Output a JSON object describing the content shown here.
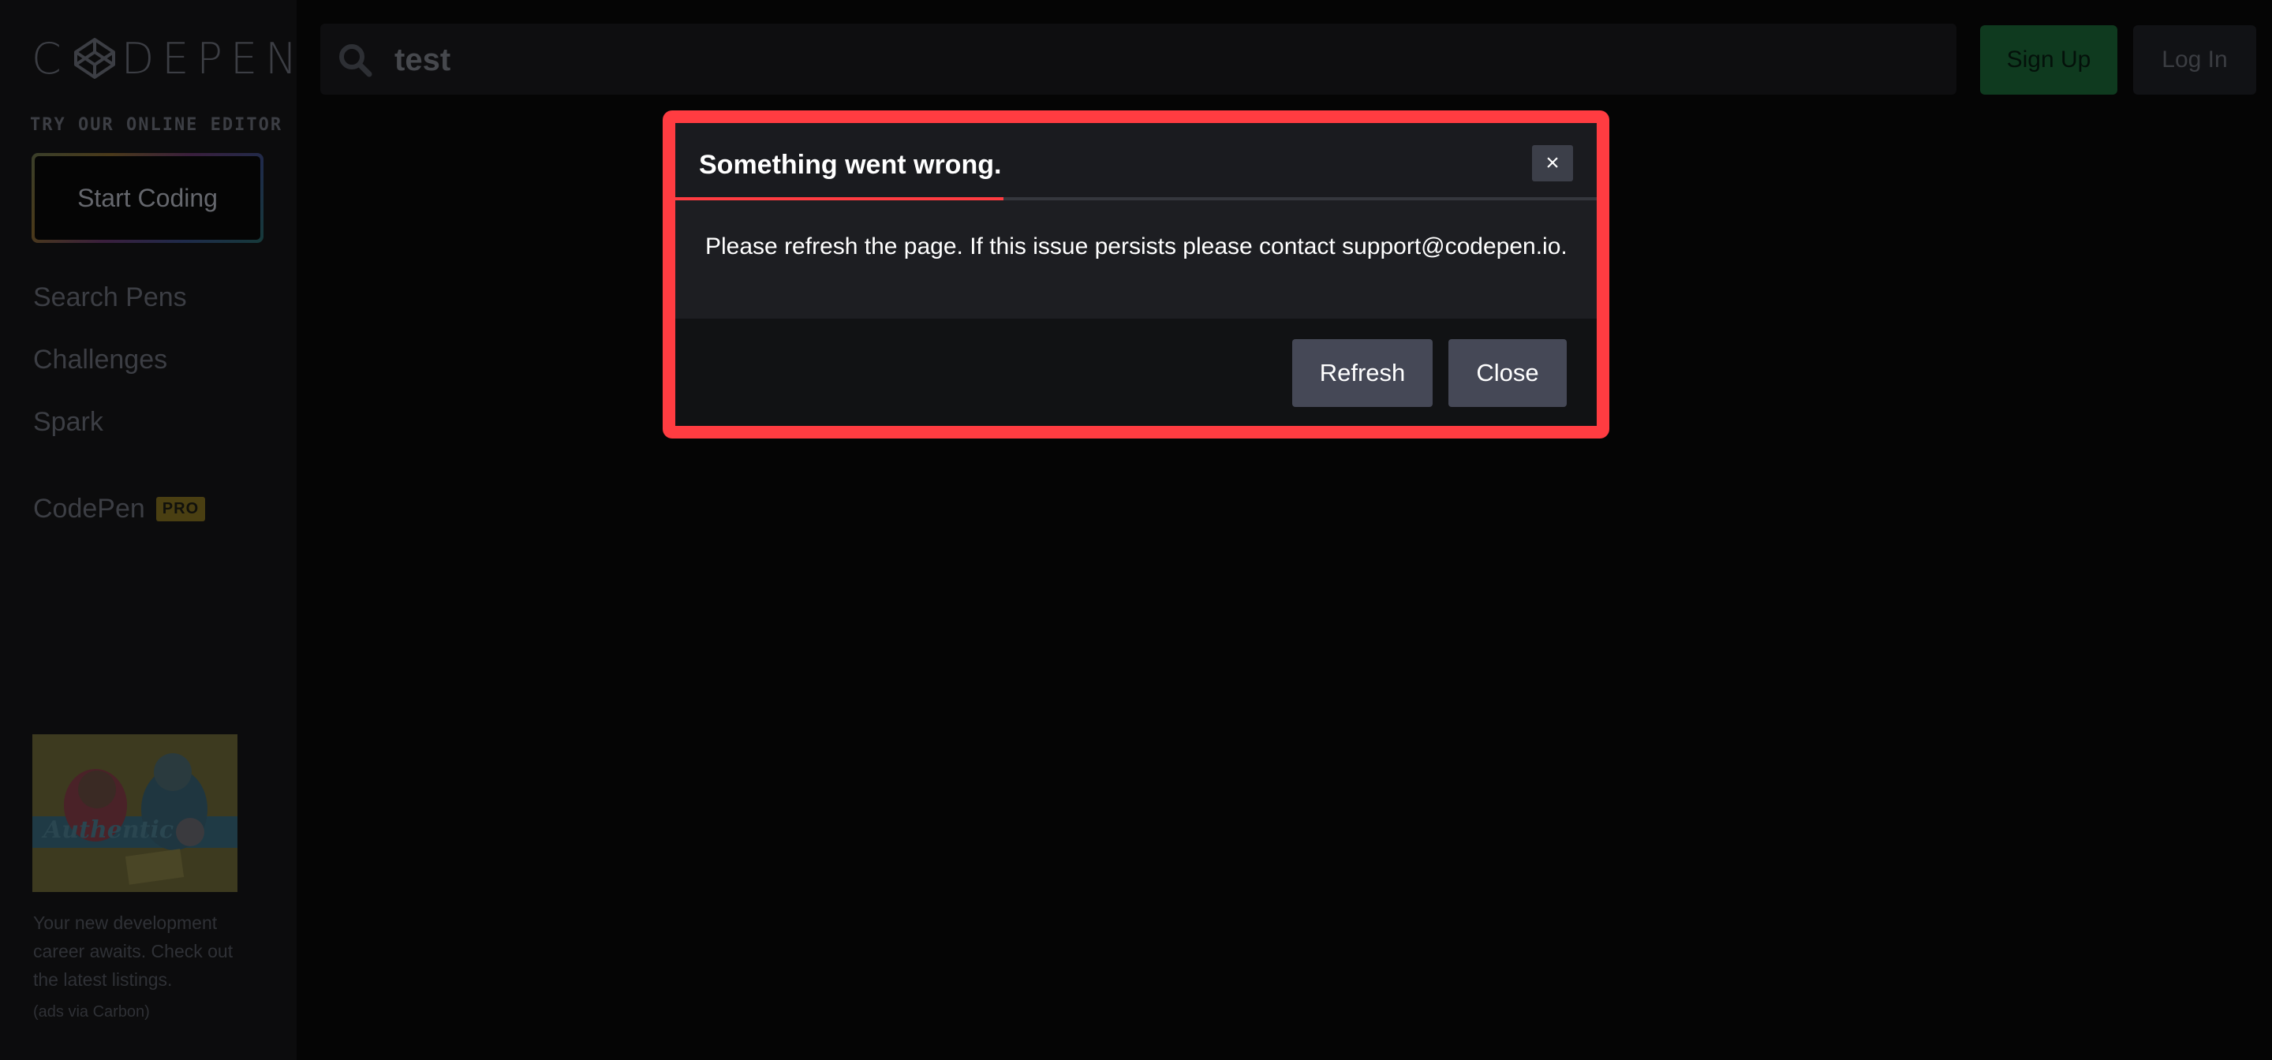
{
  "sidebar": {
    "logo_text": "CODEPEN",
    "try_label": "TRY OUR ONLINE EDITOR",
    "start_button": "Start Coding",
    "nav": [
      {
        "label": "Search Pens"
      },
      {
        "label": "Challenges"
      },
      {
        "label": "Spark"
      }
    ],
    "pro": {
      "label": "CodePen",
      "badge": "PRO"
    },
    "ad": {
      "image_text": "Authentic",
      "text": "Your new development career awaits. Check out the latest listings.",
      "via": "(ads via Carbon)"
    }
  },
  "header": {
    "search_value": "test",
    "signup": "Sign Up",
    "login": "Log In"
  },
  "modal": {
    "title": "Something went wrong.",
    "close_icon": "×",
    "message": "Please refresh the page. If this issue persists please contact support@codepen.io.",
    "refresh_button": "Refresh",
    "close_button": "Close",
    "highlight_color": "#ff3c41"
  }
}
